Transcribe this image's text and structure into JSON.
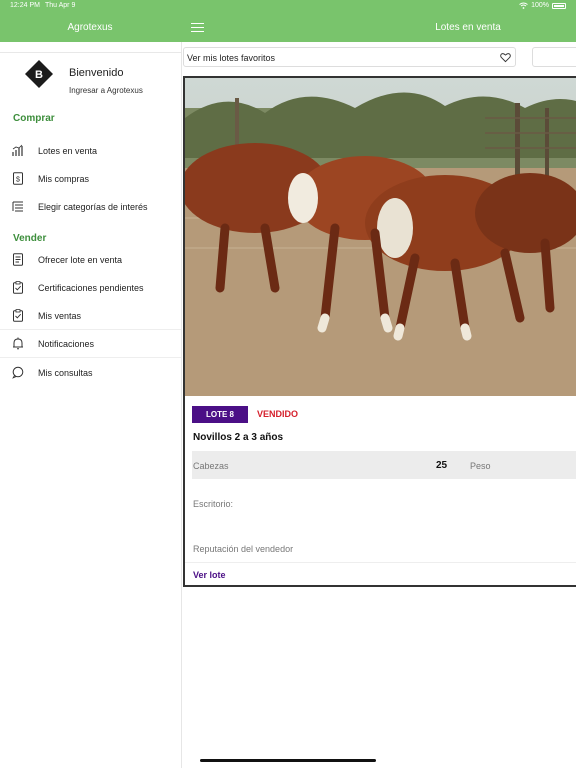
{
  "status_bar": {
    "time": "12:24 PM",
    "date": "Thu Apr 9",
    "battery": "100%"
  },
  "header": {
    "app_title": "Agrotexus",
    "page_title": "Lotes en venta"
  },
  "sidebar": {
    "avatar_letter": "B",
    "welcome": "Bienvenido",
    "login": "Ingresar a Agrotexus",
    "sections": {
      "buy": "Comprar",
      "sell": "Vender"
    },
    "items": [
      {
        "label": "Lotes en venta",
        "icon": "bar-chart-icon"
      },
      {
        "label": "Mis compras",
        "icon": "receipt-icon"
      },
      {
        "label": "Elegir categorías de interés",
        "icon": "list-icon"
      },
      {
        "label": "Ofrecer lote en venta",
        "icon": "document-icon"
      },
      {
        "label": "Certificaciones pendientes",
        "icon": "clipboard-icon"
      },
      {
        "label": "Mis ventas",
        "icon": "clipboard-check-icon"
      },
      {
        "label": "Notificaciones",
        "icon": "bell-icon"
      },
      {
        "label": "Mis consultas",
        "icon": "chat-bubble-icon"
      }
    ]
  },
  "filter": {
    "favorites_label": "Ver mis lotes favoritos"
  },
  "lot": {
    "badge": "LOTE 8",
    "status": "VENDIDO",
    "title": "Novillos 2 a 3 años",
    "heads_label": "Cabezas",
    "heads_value": "25",
    "weight_label": "Peso",
    "office_label": "Escritorio:",
    "reputation_label": "Reputación del vendedor",
    "view_link": "Ver lote"
  },
  "colors": {
    "header_green": "#79c46c",
    "section_green": "#3d8e3c",
    "purple": "#4b0f86",
    "sold_red": "#d51f2b"
  }
}
